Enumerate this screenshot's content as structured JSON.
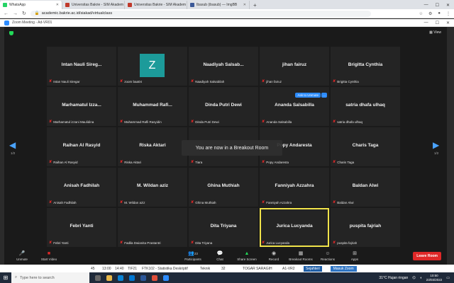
{
  "browser": {
    "tabs": [
      {
        "title": "WhatsApp",
        "color": "#25d366"
      },
      {
        "title": "Universitas Bakrie - SIM Akadem",
        "color": "#c0392b"
      },
      {
        "title": "Universitas Bakrie - SIM Akadem",
        "color": "#c0392b"
      },
      {
        "title": "Ibasub (ibasub) — ImgBB",
        "color": "#3b5998"
      }
    ],
    "new_tab": "+",
    "url": "academic.bakrie.ac.id/siakad/virtualclass"
  },
  "zoom": {
    "window_title": "Zoom Meeting - Ad-VR01",
    "view_label": "View",
    "breakout_message": "You are now in a Breakout Room",
    "page_left": "1/2",
    "page_right": "1/2",
    "ask_unmute": "Ask to Unmute",
    "ask_more": "...",
    "tiles": [
      {
        "name": "Intan Nauli Sireg...",
        "label": "Intan Nauli Siregar"
      },
      {
        "name": "",
        "label": "zoom baa04",
        "avatar": "Z"
      },
      {
        "name": "Naadiyah Salsab...",
        "label": "Naadiyah Salsabilah"
      },
      {
        "name": "jihan fairuz",
        "label": "jihan fairuz"
      },
      {
        "name": "Brigitta Cynthia",
        "label": "Brigitta Cynthia"
      },
      {
        "name": "Marhamatul Izza...",
        "label": "Marhamatul izzani Maulidina"
      },
      {
        "name": "Muhammad Rafi...",
        "label": "Muhammad Rafli Rasyidin"
      },
      {
        "name": "Dinda Putri Dewi",
        "label": "Dinda Putri Dewi"
      },
      {
        "name": "Ananda Salsabilla",
        "label": "Ananda Salsabilla",
        "ask": true
      },
      {
        "name": "satria dhafa ulhaq",
        "label": "satria dhafa ulhaq"
      },
      {
        "name": "Raihan Al Rasyid",
        "label": "Raihan Al Rasyid"
      },
      {
        "name": "Riska Aktari",
        "label": "Riska Aktari"
      },
      {
        "name": "",
        "label": "Tiara"
      },
      {
        "name": "Popy Andaresta",
        "label": "Popy Andaresta"
      },
      {
        "name": "Charis Taga",
        "label": "Charis Taga"
      },
      {
        "name": "Anisah Fadhilah",
        "label": "Anisah Fadhilah"
      },
      {
        "name": "M. Wildan aziz",
        "label": "M. Wildan aziz"
      },
      {
        "name": "Ghina Muthiah",
        "label": "Ghina Muthiah"
      },
      {
        "name": "Fanniyah Azzahra",
        "label": "Fanniyah Azzahra"
      },
      {
        "name": "Baldan Alwi",
        "label": "Baldan Alwi"
      },
      {
        "name": "Febri Yanti",
        "label": "Febri Yanti"
      },
      {
        "name": "",
        "label": "Fadila Dwianita Prastantri"
      },
      {
        "name": "Dita Triyana",
        "label": "Dita Triyana"
      },
      {
        "name": "Jurica Lucyanda",
        "label": "Jurica Lucyanda",
        "active": true
      },
      {
        "name": "puspita fajriah",
        "label": "puspita fajriah"
      }
    ],
    "toolbar": {
      "unmute": "Unmute",
      "start_video": "Start Video",
      "participants": "Participants",
      "participants_count": "23",
      "chat": "Chat",
      "share_screen": "Share Screen",
      "record": "Record",
      "breakout_rooms": "Breakout Rooms",
      "reactions": "Reactions",
      "apps": "Apps",
      "leave": "Leave Room"
    },
    "accent_color": "#2d8cff",
    "highlight_color": "#f0e34a"
  },
  "page_row": {
    "no": "45",
    "start": "13:00",
    "end": "14:40",
    "class": "TIF21",
    "course": "FTK102 - Statistika Deskriptif",
    "dept": "Teknik",
    "count": "32",
    "lecturer": "TOGAR SARAGIH",
    "room": "A1-VR2",
    "btn1": "Sejahteri",
    "btn2": "Masuk Zoom"
  },
  "taskbar": {
    "search_placeholder": "Type here to search",
    "weather": "31°C  Hujan ringan",
    "time": "10:50",
    "date": "23/03/2022"
  }
}
